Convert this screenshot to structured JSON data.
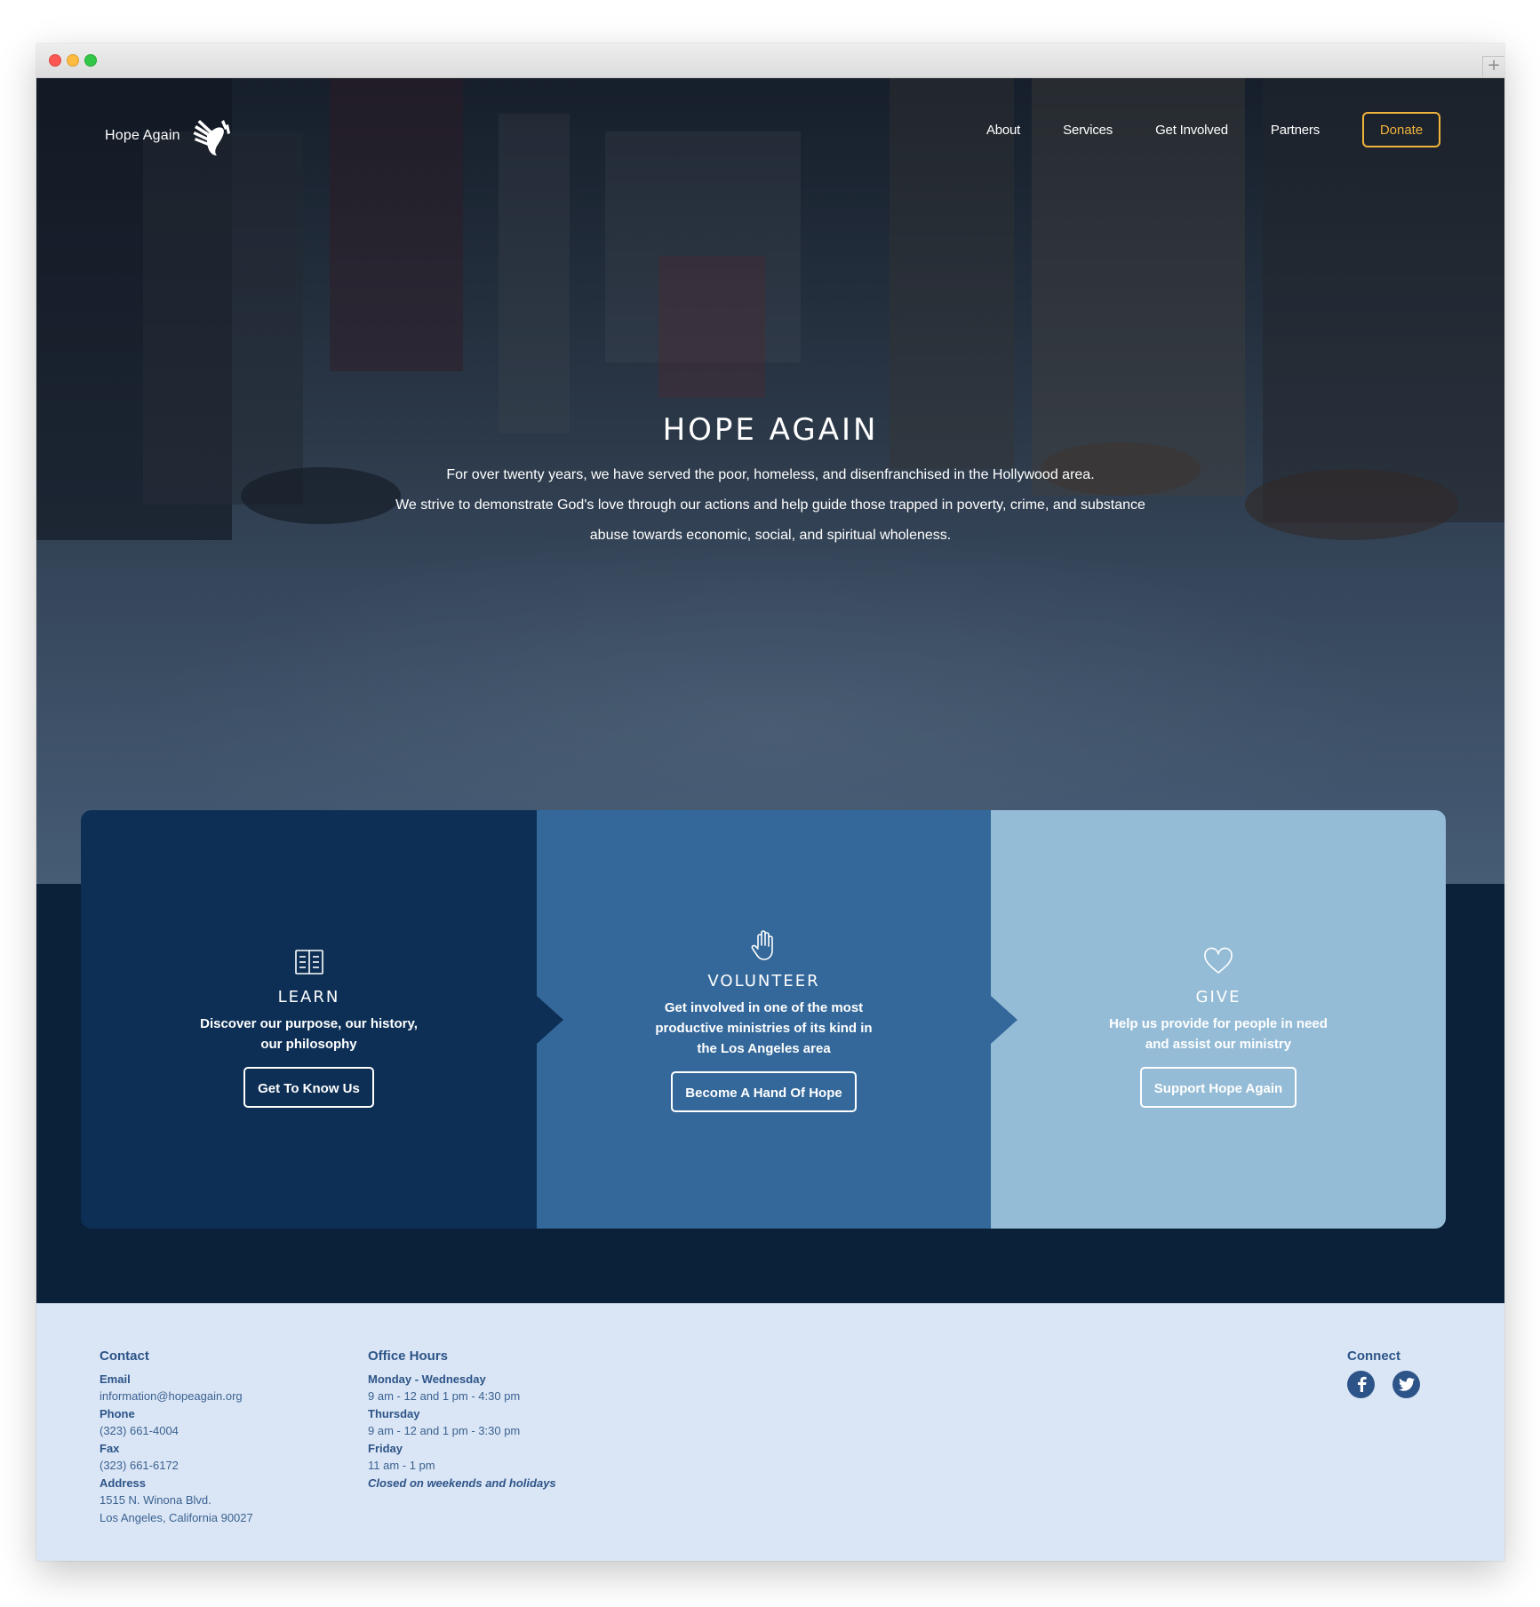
{
  "nav": {
    "logo_text": "Hope Again",
    "links": [
      "About",
      "Services",
      "Get Involved",
      "Partners"
    ],
    "donate_label": "Donate"
  },
  "hero": {
    "title": "HOPE AGAIN",
    "lines": [
      "For over twenty years, we have served the poor, homeless, and disenfranchised in the Hollywood area.",
      "We strive to demonstrate God's love through our actions and help guide those trapped in poverty, crime, and substance",
      "abuse towards economic, social, and spiritual wholeness."
    ]
  },
  "cards": [
    {
      "icon": "book-icon",
      "title": "LEARN",
      "desc": "Discover our purpose, our history, our philosophy",
      "button": "Get To Know Us",
      "color": "#0d2f55"
    },
    {
      "icon": "hand-icon",
      "title": "VOLUNTEER",
      "desc": "Get involved in one of the most productive ministries of its kind in the Los Angeles area",
      "button": "Become A Hand Of Hope",
      "color": "#34689a"
    },
    {
      "icon": "heart-icon",
      "title": "GIVE",
      "desc": "Help us provide for people in need and assist our ministry",
      "button": "Support Hope Again",
      "color": "#95bcd6"
    }
  ],
  "footer": {
    "contact": {
      "heading": "Contact",
      "email_label": "Email",
      "email": "information@hopeagain.org",
      "phone_label": "Phone",
      "phone": "(323) 661-4004",
      "fax_label": "Fax",
      "fax": "(323) 661-6172",
      "address_label": "Address",
      "address_line1": "1515 N. Winona Blvd.",
      "address_line2": "Los Angeles, California 90027"
    },
    "hours": {
      "heading": "Office Hours",
      "mon_wed_label": "Monday - Wednesday",
      "mon_wed": "9 am - 12 and 1 pm - 4:30 pm",
      "thu_label": "Thursday",
      "thu": "9 am - 12 and 1 pm - 3:30 pm",
      "fri_label": "Friday",
      "fri": "11 am - 1 pm",
      "closed_note": "Closed on weekends and holidays"
    },
    "connect": {
      "heading": "Connect",
      "icons": [
        "facebook-icon",
        "twitter-icon"
      ]
    }
  },
  "colors": {
    "accent": "#f2b33c",
    "navy": "#0d2f55",
    "blue": "#34689a",
    "light_blue": "#95bcd6",
    "footer_bg": "#dae6f5",
    "footer_text": "#2d5488"
  }
}
